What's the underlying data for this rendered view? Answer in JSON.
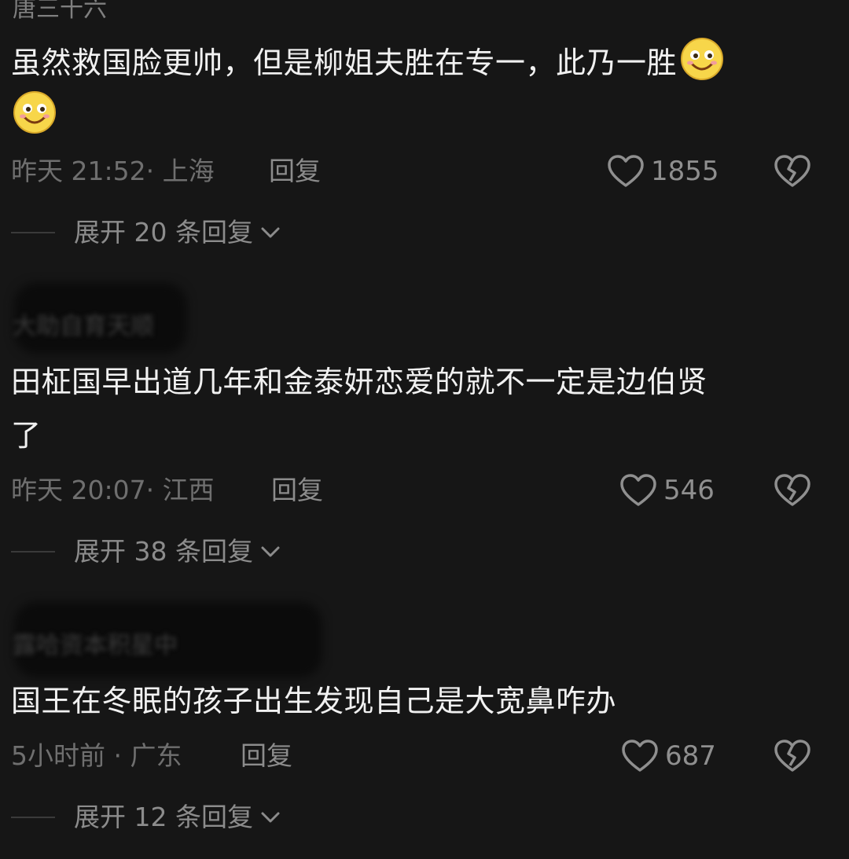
{
  "comments": [
    {
      "username": "唐三十六",
      "text": "虽然救国脸更帅，但是柳姐夫胜在专一，此乃一胜",
      "emoji": "smiley-emoji",
      "time": "昨天 21:52",
      "location": "上海",
      "reply_label": "回复",
      "likes": "1855",
      "expand_label": "展开 20 条回复"
    },
    {
      "username": "大助自育天顺",
      "text_line1": "田柾国早出道几年和金泰妍恋爱的就不一定是边伯贤",
      "text_line2": "了",
      "time": "昨天 20:07",
      "location": "江西",
      "reply_label": "回复",
      "likes": "546",
      "expand_label": "展开 38 条回复"
    },
    {
      "username": "露哈资本积星中",
      "text": "国王在冬眠的孩子出生发现自己是大宽鼻咋办",
      "time": "5小时前",
      "location": "广东",
      "reply_label": "回复",
      "likes": "687",
      "expand_label": "展开 12 条回复"
    }
  ],
  "colors": {
    "background": "#161616",
    "primary_text": "#f1f1f1",
    "secondary_text": "#8c8c8c",
    "emoji_yellow": "#f7d64a"
  }
}
